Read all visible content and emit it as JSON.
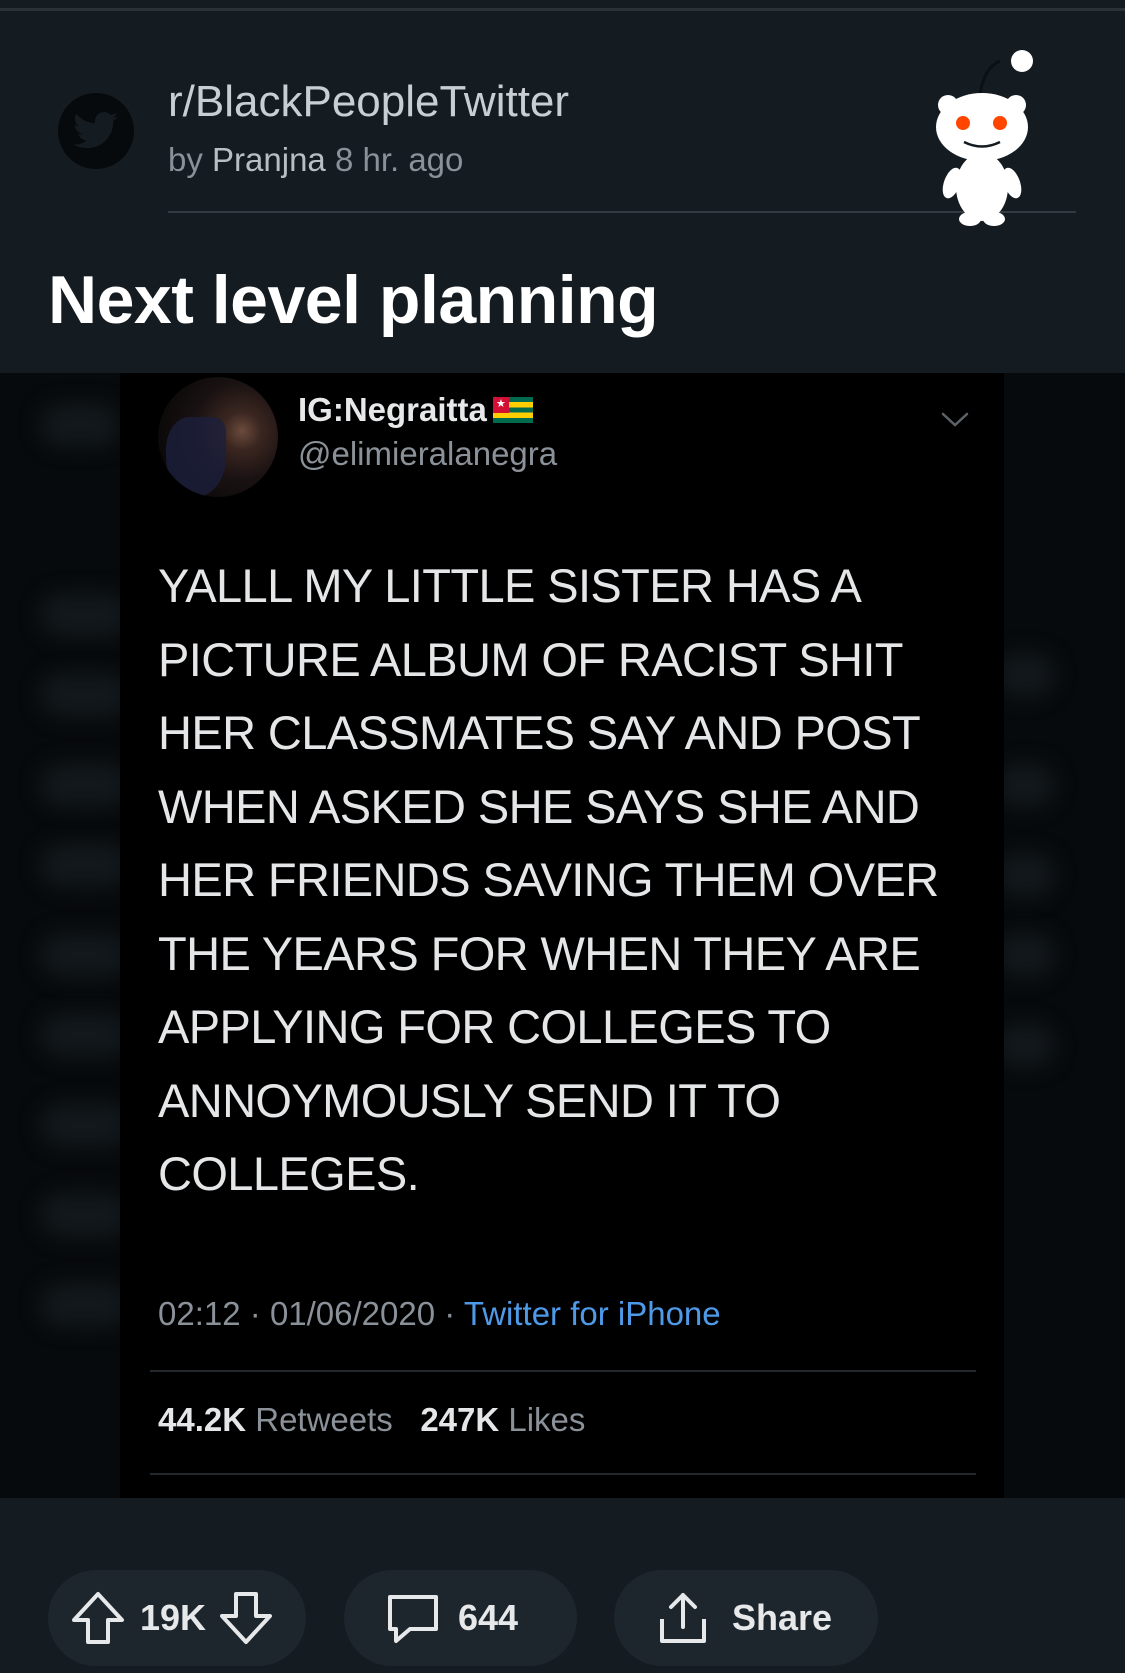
{
  "post": {
    "subreddit": "r/BlackPeopleTwitter",
    "by_label": "by",
    "author": "Pranjna",
    "age": "8 hr. ago",
    "title": "Next level planning"
  },
  "tweet": {
    "display_name": "IG:Negraitta",
    "handle": "@elimieralanegra",
    "text": "YALLL MY LITTLE SISTER HAS A PICTURE ALBUM OF RACIST SHIT HER CLASSMATES SAY AND POST WHEN ASKED SHE SAYS SHE AND HER FRIENDS SAVING THEM OVER THE YEARS FOR WHEN THEY  ARE APPLYING FOR COLLEGES TO ANNOYMOUSLY SEND IT TO COLLEGES.",
    "time": "02:12",
    "date": "01/06/2020",
    "separator": "·",
    "source": "Twitter for iPhone",
    "retweets_count": "44.2K",
    "retweets_label": "Retweets",
    "likes_count": "247K",
    "likes_label": "Likes",
    "flag_icon": "togo-flag-icon"
  },
  "actions": {
    "votes": "19K",
    "comments": "644",
    "share_label": "Share"
  },
  "colors": {
    "background": "#141b21",
    "link_blue": "#4f9ae8",
    "snoo_red": "#ff4500"
  }
}
